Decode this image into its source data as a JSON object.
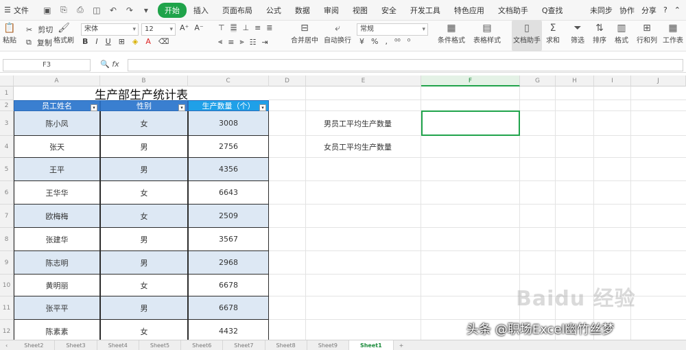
{
  "menu": {
    "file": "文件",
    "tabs": [
      {
        "label": "开始",
        "active": true
      },
      {
        "label": "插入"
      },
      {
        "label": "页面布局"
      },
      {
        "label": "公式"
      },
      {
        "label": "数据"
      },
      {
        "label": "审阅"
      },
      {
        "label": "视图"
      },
      {
        "label": "安全"
      },
      {
        "label": "开发工具"
      },
      {
        "label": "特色应用"
      },
      {
        "label": "文档助手"
      },
      {
        "label": "Q查找"
      }
    ],
    "right": [
      "未同步",
      "协作",
      "分享"
    ]
  },
  "ribbon": {
    "paste": "粘贴",
    "cut": "剪切",
    "copy": "复制",
    "format_painter": "格式刷",
    "font_name": "宋体",
    "font_size": "12",
    "merge": "合并居中",
    "wrap": "自动换行",
    "number_format": "常规",
    "cond_format": "条件格式",
    "table_style": "表格样式",
    "doc_assist": "文档助手",
    "sum": "求和",
    "filter": "筛选",
    "sort": "排序",
    "fmt": "格式",
    "rowcol": "行和列",
    "worksheet": "工作表"
  },
  "formula_bar": {
    "cell_ref": "F3",
    "fx": "fx",
    "value": ""
  },
  "columns": [
    "A",
    "B",
    "C",
    "D",
    "E",
    "F",
    "G",
    "H",
    "I",
    "J"
  ],
  "rows": [
    "1",
    "2",
    "3",
    "4",
    "5",
    "6",
    "7",
    "8",
    "9",
    "10",
    "11",
    "12"
  ],
  "sheet_title": "生产部生产统计表",
  "table": {
    "headers": [
      "员工姓名",
      "性别",
      "生产数量（个）"
    ],
    "rows": [
      [
        "陈小凤",
        "女",
        "3008"
      ],
      [
        "张天",
        "男",
        "2756"
      ],
      [
        "王平",
        "男",
        "4356"
      ],
      [
        "王华华",
        "女",
        "6643"
      ],
      [
        "欧梅梅",
        "女",
        "2509"
      ],
      [
        "张建华",
        "男",
        "3567"
      ],
      [
        "陈志明",
        "男",
        "2968"
      ],
      [
        "黄明丽",
        "女",
        "6678"
      ],
      [
        "张平平",
        "男",
        "6678"
      ],
      [
        "陈素素",
        "女",
        "4432"
      ]
    ]
  },
  "labels": {
    "male_avg": "男员工平均生产数量",
    "female_avg": "女员工平均生产数量"
  },
  "sheet_tabs": [
    "Sheet2",
    "Sheet3",
    "Sheet4",
    "Sheet5",
    "Sheet6",
    "Sheet7",
    "Sheet8",
    "Sheet9"
  ],
  "active_sheet": "Sheet1",
  "add_sheet": "+",
  "watermark": {
    "baidu": "Baidu 经验",
    "credit": "头条 @职场Excel幽竹丝梦"
  },
  "colors": {
    "accent": "#1fa34a",
    "header_blue": "#3a7fd0",
    "band": "#dde8f4"
  }
}
